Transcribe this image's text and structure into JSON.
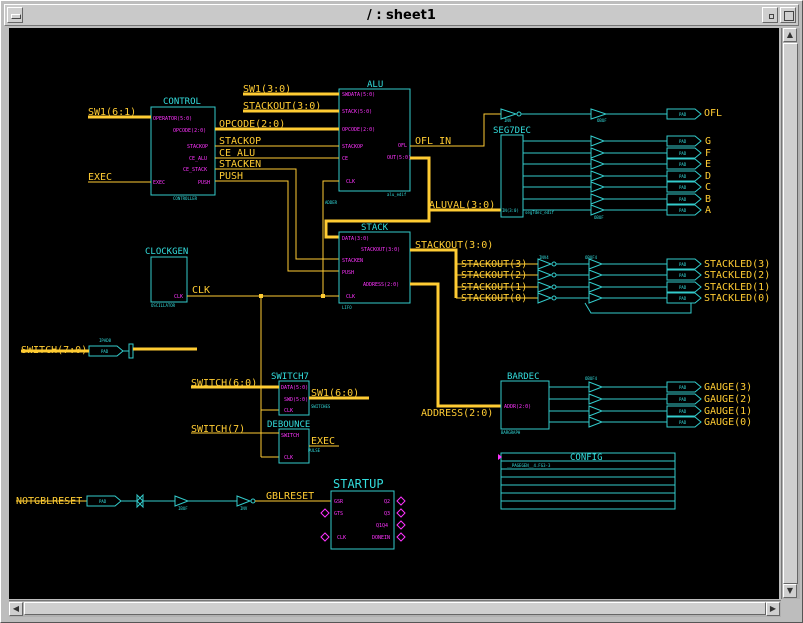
{
  "window": {
    "title": "/ : sheet1"
  },
  "schematic": {
    "blocks": {
      "control": {
        "name": "CONTROL",
        "pins": [
          "OPERATOR(5:0)",
          "OPCODE(2:0)",
          "STACKOP",
          "CE_ALU",
          "CE_STACK",
          "EXEC",
          "PUSH"
        ],
        "type": "CONTROLLER"
      },
      "alu": {
        "name": "ALU",
        "pins": [
          "SWDATA(5:0)",
          "STACK(5:0)",
          "OPCODE(2:0)",
          "STACKOP",
          "CE",
          "CLK",
          "OFL",
          "OUT(5:0)"
        ],
        "type": "alu_edif",
        "sub": "ADDER"
      },
      "seg7dec": {
        "name": "SEG7DEC",
        "type": "seg7dec_edif",
        "sub": "IN(3:0)"
      },
      "stack": {
        "name": "STACK",
        "pins": [
          "DATA(3:0)",
          "STACKEN",
          "PUSH",
          "CLK",
          "STACKOUT(3:0)",
          "ADDRESS(2:0)"
        ],
        "type": "LIFO"
      },
      "clockgen": {
        "name": "CLOCKGEN",
        "pins": [
          "CLK"
        ],
        "type": "OSCILLATOR"
      },
      "switch7": {
        "name": "SWITCH7",
        "pins": [
          "DATA(5:0)",
          "SWD(5:0)",
          "CLK"
        ],
        "type": "SWITCHES"
      },
      "debounce": {
        "name": "DEBOUNCE",
        "pins": [
          "SWITCH",
          "EXEC",
          "CLK"
        ],
        "type": "PULSE"
      },
      "bardec": {
        "name": "BARDEC",
        "pins": [
          "ADDR(2:0)"
        ],
        "type": "BARGRAPH"
      },
      "startup": {
        "name": "STARTUP",
        "pins": [
          "GSR",
          "GTS",
          "CLK",
          "Q2",
          "Q3",
          "Q1Q4",
          "DONEIN"
        ]
      },
      "config": {
        "name": "CONFIG",
        "line": "__PAGEGEN__4.FG3-3"
      }
    },
    "nets": {
      "sw_6_1": "SW1(6:1)",
      "exec": "EXEC",
      "sw1_3_0": "SW1(3:0)",
      "stackout_3_0": "STACKOUT(3:0)",
      "opcode_2_0": "OPCODE(2:0)",
      "stackop": "STACKOP",
      "ce_alu": "CE_ALU",
      "stacken": "STACKEN",
      "push": "PUSH",
      "ofl_in": "OFL_IN",
      "aluval": "ALUVAL(3:0)",
      "stackout_bus": "STACKOUT(3:0)",
      "stackout_bits": [
        "STACKOUT(3)",
        "STACKOUT(2)",
        "STACKOUT(1)",
        "STACKOUT(0)"
      ],
      "clk": "CLK",
      "switch_7_0": "SWITCH(7:0)",
      "switch_6_0": "SWITCH(6:0)",
      "sw1_6_0": "SW1(6:0)",
      "switch_7": "SWITCH(7)",
      "exec2": "EXEC",
      "address": "ADDRESS(2:0)",
      "notgblreset": "NOTGBLRESET",
      "gblreset": "GBLRESET"
    },
    "outputs": {
      "ofl": "OFL",
      "segments": [
        "G",
        "F",
        "E",
        "D",
        "C",
        "B",
        "A"
      ],
      "stackled": [
        "STACKLED(3)",
        "STACKLED(2)",
        "STACKLED(1)",
        "STACKLED(0)"
      ],
      "gauge": [
        "GAUGE(3)",
        "GAUGE(2)",
        "GAUGE(1)",
        "GAUGE(0)"
      ]
    },
    "symbols": {
      "pad": "PAD",
      "obuf": "OBUF",
      "inv": "INV",
      "ibuf": "IBUF",
      "ipad8": "IPAD8",
      "obuf4": "OBUF4",
      "inv4": "INV4"
    }
  },
  "colors": {
    "canvas": "#000000",
    "wire": "#ffcc33",
    "symbol": "#33cccc",
    "pin": "#ff33ff",
    "frame": "#c6c6c6"
  }
}
